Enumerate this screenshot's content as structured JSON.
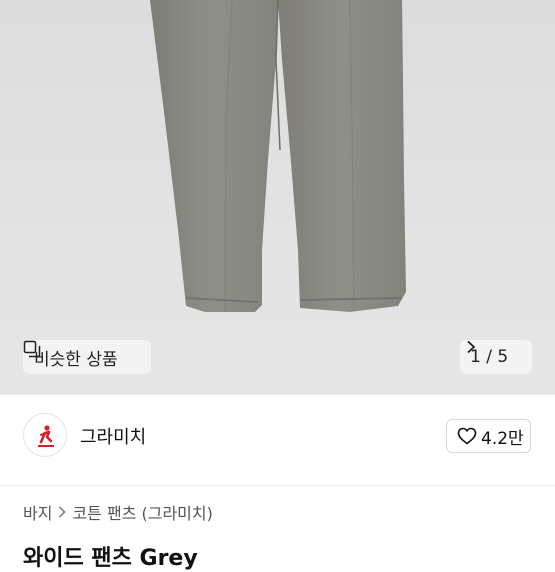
{
  "product_gallery": {
    "similar_button_label": "비슷한 상품",
    "page_indicator": "1 / 5"
  },
  "shop": {
    "name": "그라미치",
    "like_count": "4.2만"
  },
  "breadcrumb": {
    "items": [
      "바지",
      "코튼 팬츠 (그라미치)"
    ]
  },
  "product": {
    "title": "와이드 팬츠 Grey"
  },
  "colors": {
    "pants": "#8b8a84",
    "photo_bg": "#e0e0e0",
    "logo_red": "#d4212b"
  }
}
